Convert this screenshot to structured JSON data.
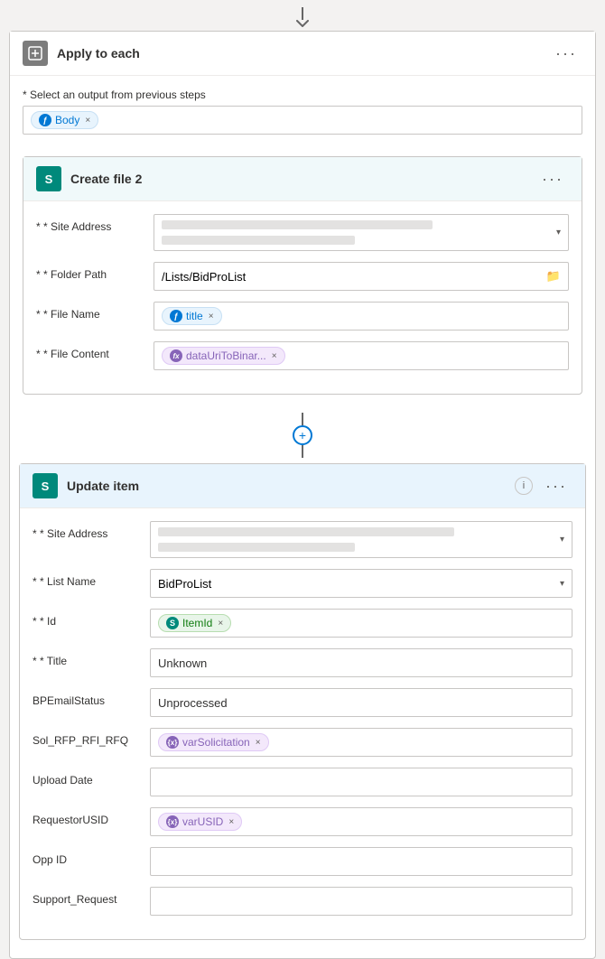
{
  "top_arrow": "↓",
  "apply_each": {
    "title": "Apply to each",
    "more_icon": "···",
    "select_label": "* Select an output from previous steps",
    "body_token": "Body",
    "create_file": {
      "title": "Create file 2",
      "more_icon": "···",
      "site_address_label": "* Site Address",
      "folder_path_label": "* Folder Path",
      "folder_path_value": "/Lists/BidProList",
      "file_name_label": "* File Name",
      "file_name_token": "title",
      "file_content_label": "* File Content",
      "file_content_token": "dataUriToBinar..."
    },
    "update_item": {
      "title": "Update item",
      "more_icon": "···",
      "site_address_label": "* Site Address",
      "list_name_label": "* List Name",
      "list_name_value": "BidProList",
      "id_label": "* Id",
      "id_token": "ItemId",
      "title_label": "* Title",
      "title_value": "Unknown",
      "bp_email_status_label": "BPEmailStatus",
      "bp_email_status_value": "Unprocessed",
      "sol_label": "Sol_RFP_RFI_RFQ",
      "sol_token": "varSolicitation",
      "upload_date_label": "Upload Date",
      "upload_date_value": "",
      "requestor_label": "RequestorUSID",
      "requestor_token": "varUSID",
      "opp_id_label": "Opp ID",
      "opp_id_value": "",
      "support_label": "Support_Request",
      "support_value": ""
    }
  },
  "icons": {
    "apply_each_icon": "⊟",
    "create_file_icon": "S",
    "update_item_icon": "S",
    "folder_icon": "📁",
    "body_icon": "ƒ",
    "title_icon": "ƒ",
    "content_icon": "ƒx",
    "item_id_icon": "S",
    "var_solicitation_icon": "{x}",
    "var_usid_icon": "{x}",
    "info_icon": "i"
  }
}
